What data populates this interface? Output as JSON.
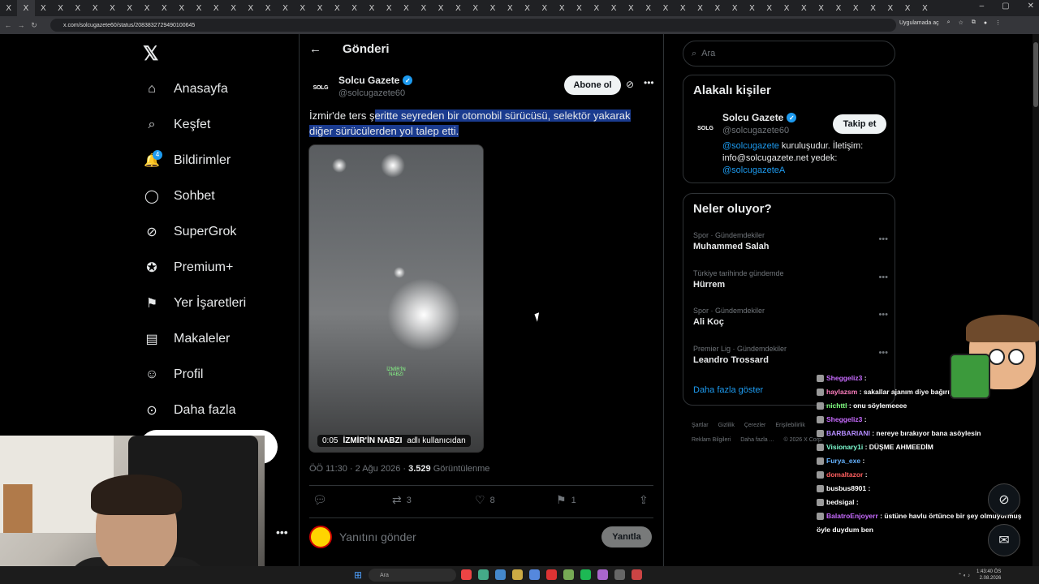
{
  "browser": {
    "tab_glyph": "X",
    "url": "x.com/solcugazete60/status/2083832729490100645",
    "app_button": "Uygulamada aç",
    "window_controls": [
      "–",
      "▢",
      "✕"
    ],
    "nav_buttons": [
      "←",
      "→",
      "↻"
    ]
  },
  "nav": {
    "logo": "𝕏",
    "items": [
      {
        "label": "Anasayfa",
        "icon": "home-icon",
        "glyph": "⌂"
      },
      {
        "label": "Keşfet",
        "icon": "search-icon",
        "glyph": "⌕"
      },
      {
        "label": "Bildirimler",
        "icon": "bell-icon",
        "glyph": "🔔",
        "badge": "4"
      },
      {
        "label": "Sohbet",
        "icon": "chat-icon",
        "glyph": "◯"
      },
      {
        "label": "SuperGrok",
        "icon": "grok-icon",
        "glyph": "⊘"
      },
      {
        "label": "Premium+",
        "icon": "verified-icon",
        "glyph": "✪"
      },
      {
        "label": "Yer İşaretleri",
        "icon": "bookmark-icon",
        "glyph": "⚑"
      },
      {
        "label": "Makaleler",
        "icon": "article-icon",
        "glyph": "▤"
      },
      {
        "label": "Profil",
        "icon": "person-icon",
        "glyph": "☺"
      },
      {
        "label": "Daha fazla",
        "icon": "more-circle-icon",
        "glyph": "⊙"
      }
    ],
    "more_dots": "•••"
  },
  "main": {
    "back_glyph": "←",
    "header_title": "Gönderi",
    "author": {
      "name": "Solcu Gazete",
      "handle": "@solcugazete60",
      "avatar_text": "SOLG"
    },
    "subscribe_label": "Abone ol",
    "text_prefix": "İzmir'de ters ş",
    "text_selected": "eritte seyreden bir otomobil sürücüsü, selektör yakarak diğer sürücülerden yol talep etti.",
    "video": {
      "duration": "0:05",
      "credit_bold": "İZMİR'İN NABZI",
      "credit_rest": "adlı kullanıcıdan",
      "watermark": "İZMİR'İN NABZI"
    },
    "meta": {
      "time": "ÖÖ 11:30 · 2 Ağu 2026 · ",
      "views": "3.529",
      "views_label": " Görüntülenme"
    },
    "actions": {
      "reply": "",
      "reposts": "3",
      "likes": "8",
      "bookmarks": "1"
    },
    "reply_placeholder": "Yanıtını gönder",
    "reply_button": "Yanıtla"
  },
  "sidebar": {
    "search_placeholder": "Ara",
    "related": {
      "title": "Alakalı kişiler",
      "name": "Solcu Gazete",
      "handle": "@solcugazete60",
      "avatar_text": "SOLG",
      "follow_label": "Takip et",
      "bio_link1": "@solcugazete",
      "bio_text": " kuruluşudur. İletişim: info@solcugazete.net yedek: ",
      "bio_link2": "@solcugazeteA"
    },
    "trends": {
      "title": "Neler oluyor?",
      "items": [
        {
          "category": "Spor · Gündemdekiler",
          "name": "Muhammed Salah"
        },
        {
          "category": "Türkiye tarihinde gündemde",
          "name": "Hürrem"
        },
        {
          "category": "Spor · Gündemdekiler",
          "name": "Ali Koç"
        },
        {
          "category": "Premier Lig · Gündemdekiler",
          "name": "Leandro Trossard"
        }
      ],
      "show_more": "Daha fazla göster"
    },
    "footer": {
      "links": [
        "Şartlar",
        "Gizlilik",
        "Çerezler",
        "Erişilebilirlik",
        "Reklam Bilgileri",
        "Daha fazla ...",
        "© 2026 X Corp."
      ]
    }
  },
  "stream_chat": [
    {
      "user": "Sheggeliz3",
      "msg": ":",
      "color": "#c86bff"
    },
    {
      "user": "haylazsm",
      "msg": ": sakallar ajanım diye bağırıyor",
      "color": "#ff7fbf"
    },
    {
      "user": "nichttl",
      "msg": ": onu söylemeeee",
      "color": "#7fff7f"
    },
    {
      "user": "Sheggeliz3",
      "msg": ":",
      "color": "#c86bff"
    },
    {
      "user": "BARBARIANI",
      "msg": ": nereye bırakıyor bana asöylesin",
      "color": "#b48cff"
    },
    {
      "user": "Visionary1i",
      "msg": ": DÜŞME AHMEEDİM",
      "color": "#7fffd4"
    },
    {
      "user": "Furya_exe",
      "msg": ":",
      "color": "#66b3ff"
    },
    {
      "user": "domaltazor",
      "msg": ":",
      "color": "#ff5f5f"
    },
    {
      "user": "busbus8901",
      "msg": ":",
      "color": "#ffffff"
    },
    {
      "user": "bedsigal",
      "msg": ":",
      "color": "#ffffff"
    },
    {
      "user": "BalatroEnjoyerr",
      "msg": ": üstüne havlu örtünce bir şey olmuyormuş öyle duydum ben",
      "color": "#c86bff"
    }
  ],
  "taskbar": {
    "search": "Ara",
    "time": "1:43:40 ÖS",
    "date": "2.08.2026"
  },
  "colors": {
    "accent": "#1d9bf0",
    "background": "#000000",
    "selection": "#1a3b8f"
  }
}
